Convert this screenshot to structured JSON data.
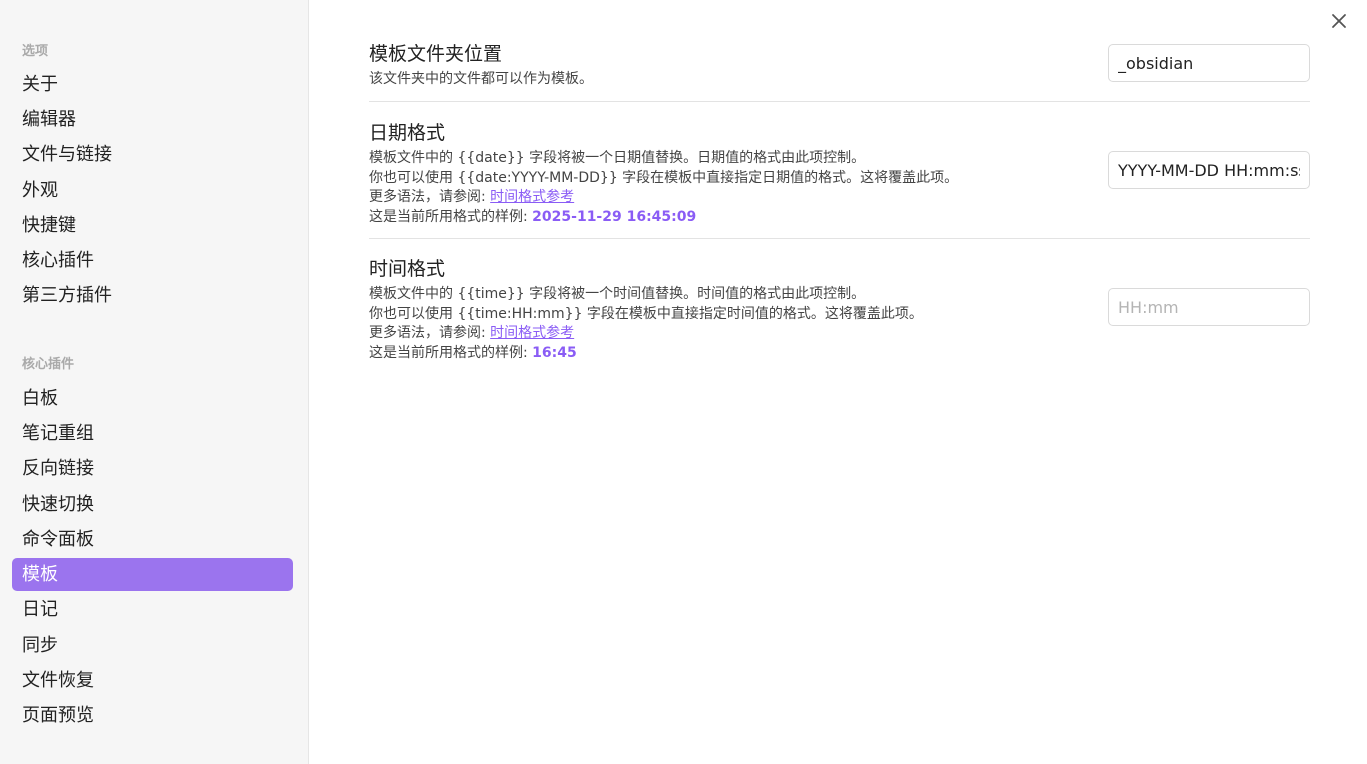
{
  "sidebar": {
    "options_heading": "选项",
    "options_items": [
      {
        "label": "关于"
      },
      {
        "label": "编辑器"
      },
      {
        "label": "文件与链接"
      },
      {
        "label": "外观"
      },
      {
        "label": "快捷键"
      },
      {
        "label": "核心插件"
      },
      {
        "label": "第三方插件"
      }
    ],
    "core_heading": "核心插件",
    "core_items": [
      {
        "label": "白板"
      },
      {
        "label": "笔记重组"
      },
      {
        "label": "反向链接"
      },
      {
        "label": "快速切换"
      },
      {
        "label": "命令面板"
      },
      {
        "label": "模板",
        "active": true
      },
      {
        "label": "日记"
      },
      {
        "label": "同步"
      },
      {
        "label": "文件恢复"
      },
      {
        "label": "页面预览"
      }
    ]
  },
  "accent_color": "#9b74ee",
  "settings": {
    "folder": {
      "title": "模板文件夹位置",
      "desc": "该文件夹中的文件都可以作为模板。",
      "value": "_obsidian",
      "placeholder": ""
    },
    "date": {
      "title": "日期格式",
      "desc_line1": "模板文件中的 {{date}} 字段将被一个日期值替换。日期值的格式由此项控制。",
      "desc_line2": "你也可以使用 {{date:YYYY-MM-DD}} 字段在模板中直接指定日期值的格式。这将覆盖此项。",
      "desc_line3_prefix": "更多语法，请参阅: ",
      "desc_line3_link": "时间格式参考",
      "desc_line4_prefix": "这是当前所用格式的样例: ",
      "sample": "2025-11-29 16:45:09",
      "value": "YYYY-MM-DD HH:mm:ss",
      "placeholder": ""
    },
    "time": {
      "title": "时间格式",
      "desc_line1": "模板文件中的 {{time}} 字段将被一个时间值替换。时间值的格式由此项控制。",
      "desc_line2": "你也可以使用 {{time:HH:mm}} 字段在模板中直接指定时间值的格式。这将覆盖此项。",
      "desc_line3_prefix": "更多语法，请参阅: ",
      "desc_line3_link": "时间格式参考",
      "desc_line4_prefix": "这是当前所用格式的样例: ",
      "sample": "16:45",
      "value": "",
      "placeholder": "HH:mm"
    }
  },
  "icons": {
    "close": "close-icon"
  }
}
